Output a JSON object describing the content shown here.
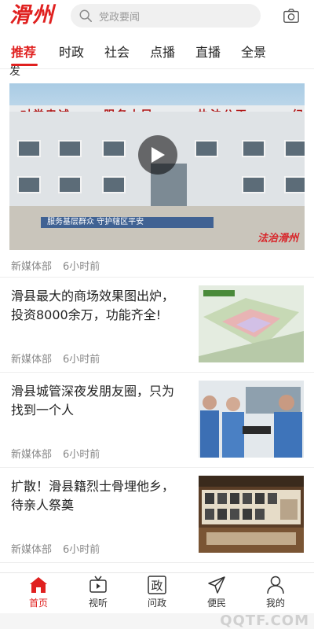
{
  "header": {
    "logo_text": "滑州",
    "search_placeholder": "党政要闻",
    "icons": [
      "search-icon",
      "camera-icon"
    ]
  },
  "tabs": [
    {
      "label": "推荐",
      "active": true
    },
    {
      "label": "时政",
      "active": false
    },
    {
      "label": "社会",
      "active": false
    },
    {
      "label": "点播",
      "active": false
    },
    {
      "label": "直播",
      "active": false
    },
    {
      "label": "全景",
      "active": false
    }
  ],
  "feed": {
    "cut_off_text": "发",
    "video": {
      "slogans": [
        "对党忠诚",
        "服务人民",
        "执法公正",
        "纪"
      ],
      "ticker_text": "服务基层群众  守护辖区平安",
      "watermark": "法治滑州",
      "source": "新媒体部",
      "time": "6小时前"
    },
    "articles": [
      {
        "title": "滑县最大的商场效果图出炉，投资8000余万，功能齐全!",
        "source": "新媒体部",
        "time": "6小时前"
      },
      {
        "title": "滑县城管深夜发朋友圈，只为找到一个人",
        "source": "新媒体部",
        "time": "6小时前"
      },
      {
        "title": "扩散！滑县籍烈士骨埋他乡，待亲人祭奠",
        "source": "新媒体部",
        "time": "6小时前"
      }
    ]
  },
  "bottom_nav": [
    {
      "label": "首页",
      "icon": "home-icon",
      "active": true
    },
    {
      "label": "视听",
      "icon": "tv-icon",
      "active": false
    },
    {
      "label": "问政",
      "icon": "zheng-icon",
      "glyph": "政",
      "active": false
    },
    {
      "label": "便民",
      "icon": "send-icon",
      "active": false
    },
    {
      "label": "我的",
      "icon": "user-icon",
      "active": false
    }
  ],
  "watermark_text": "QQTF.COM",
  "colors": {
    "accent": "#e0201f",
    "meta": "#888888",
    "divider": "#eeeeee"
  }
}
